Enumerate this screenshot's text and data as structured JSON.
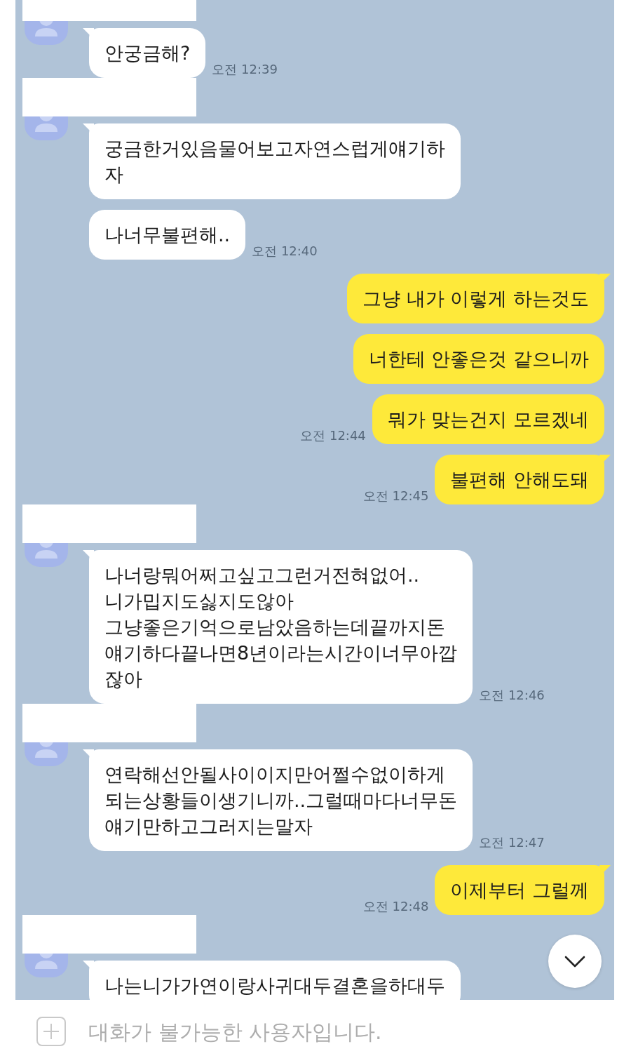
{
  "chat": {
    "groups": [
      {
        "kind": "incoming",
        "runs": [
          {
            "time": "오전 12:39",
            "messages": [
              "안궁금해?"
            ]
          }
        ]
      },
      {
        "kind": "incoming",
        "runs": [
          {
            "time": "오전 12:40",
            "messages": [
              "궁금한거있음물어보고자연스럽게얘기하\n자",
              "나너무불편해.."
            ]
          }
        ]
      },
      {
        "kind": "outgoing",
        "runs": [
          {
            "time": "오전 12:44",
            "messages": [
              "그냥 내가 이렇게 하는것도",
              "너한테 안좋은것 같으니까",
              "뭐가 맞는건지 모르겠네"
            ]
          },
          {
            "time": "오전 12:45",
            "messages": [
              "불편해 안해도돼"
            ]
          }
        ]
      },
      {
        "kind": "incoming",
        "runs": [
          {
            "time": "오전 12:46",
            "messages": [
              "나너랑뭐어쩌고싶고그런거전혀없어..\n니가밉지도싫지도않아\n그냥좋은기억으로남았음하는데끝까지돈\n얘기하다끝나면8년이라는시간이너무아깝\n잖아"
            ]
          }
        ]
      },
      {
        "kind": "incoming",
        "runs": [
          {
            "time": "오전 12:47",
            "messages": [
              "연락해선안될사이이지만어쩔수없이하게\n되는상황들이생기니까..그럴때마다너무돈\n얘기만하고그러지는말자"
            ]
          }
        ]
      },
      {
        "kind": "outgoing",
        "runs": [
          {
            "time": "오전 12:48",
            "messages": [
              "이제부터 그럴께"
            ]
          }
        ]
      },
      {
        "kind": "incoming",
        "runs": [
          {
            "messages": [
              "나는니가가연이랑사귀대두결혼을하대두"
            ]
          }
        ]
      }
    ]
  },
  "input_bar": {
    "placeholder": "대화가 불가능한 사용자입니다.",
    "disabled": true
  }
}
